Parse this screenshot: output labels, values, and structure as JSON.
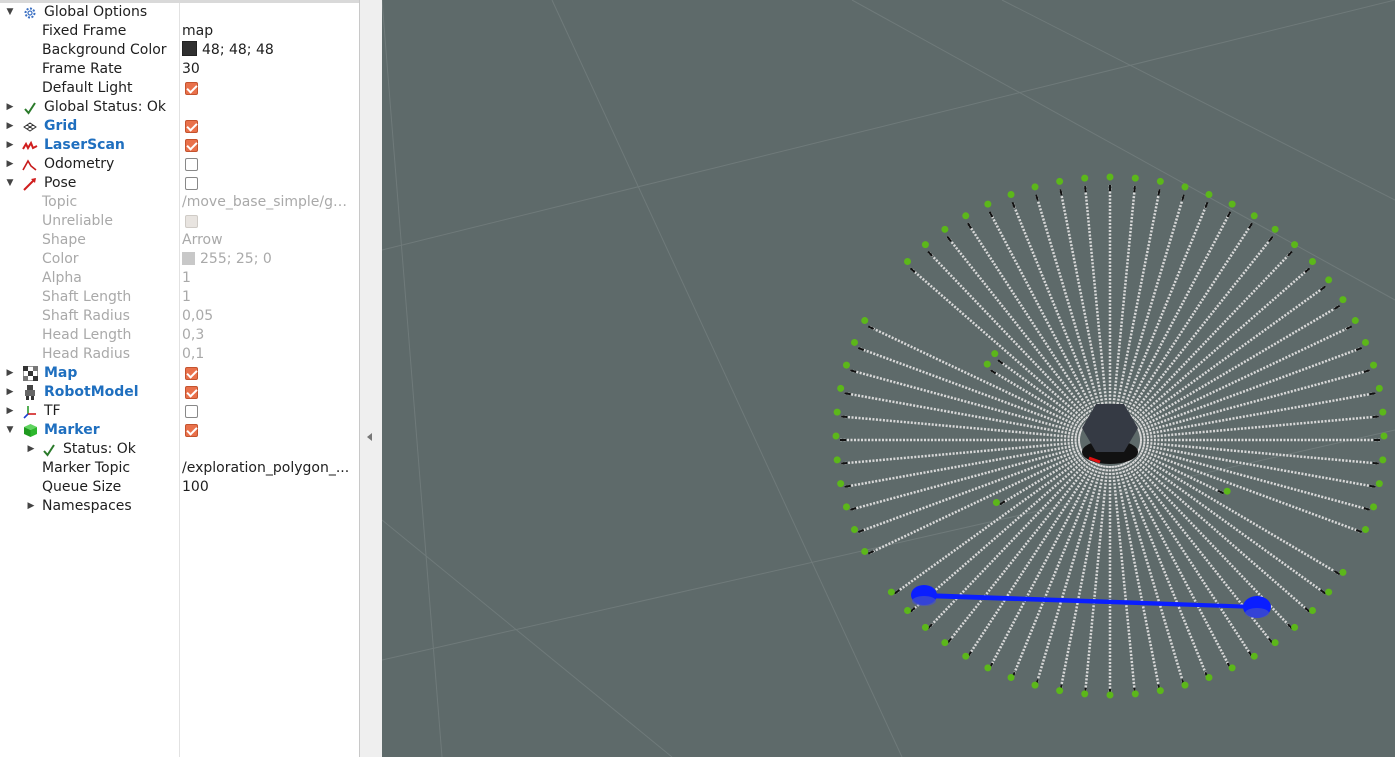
{
  "colors": {
    "viewport_bg": "#5e6a6a",
    "accent_checkbox": "#e9714b",
    "display_name": "#1f6fbf",
    "laser": "#d9d9d9",
    "endpoint": "#5cb71a",
    "marker": "#0a1eff",
    "robot": "#353a44"
  },
  "tree": {
    "global_options": {
      "label": "Global Options",
      "icon": "gear-icon",
      "fixed_frame": {
        "label": "Fixed Frame",
        "value": "map"
      },
      "background_color": {
        "label": "Background Color",
        "value": "48; 48; 48",
        "swatch": "#303030"
      },
      "frame_rate": {
        "label": "Frame Rate",
        "value": "30"
      },
      "default_light": {
        "label": "Default Light",
        "checked": true
      }
    },
    "global_status": {
      "label": "Global Status: Ok",
      "icon": "checkmark-icon"
    },
    "grid": {
      "label": "Grid",
      "icon": "grid-icon",
      "checked": true
    },
    "laserscan": {
      "label": "LaserScan",
      "icon": "laserscan-icon",
      "checked": true
    },
    "odometry": {
      "label": "Odometry",
      "icon": "odometry-icon",
      "checked": false
    },
    "pose": {
      "label": "Pose",
      "icon": "pose-arrow-icon",
      "checked": false,
      "topic": {
        "label": "Topic",
        "value": "/move_base_simple/goal"
      },
      "unreliable": {
        "label": "Unreliable"
      },
      "shape": {
        "label": "Shape",
        "value": "Arrow"
      },
      "color": {
        "label": "Color",
        "value": "255; 25; 0",
        "swatch": "#c8c8c8"
      },
      "alpha": {
        "label": "Alpha",
        "value": "1"
      },
      "shaft_length": {
        "label": "Shaft Length",
        "value": "1"
      },
      "shaft_radius": {
        "label": "Shaft Radius",
        "value": "0,05"
      },
      "head_length": {
        "label": "Head Length",
        "value": "0,3"
      },
      "head_radius": {
        "label": "Head Radius",
        "value": "0,1"
      }
    },
    "map": {
      "label": "Map",
      "icon": "map-icon",
      "checked": true
    },
    "robotmodel": {
      "label": "RobotModel",
      "icon": "robot-icon",
      "checked": true
    },
    "tf": {
      "label": "TF",
      "icon": "tf-icon",
      "checked": false
    },
    "marker": {
      "label": "Marker",
      "icon": "cube-icon",
      "checked": true,
      "status": {
        "label": "Status: Ok"
      },
      "marker_topic": {
        "label": "Marker Topic",
        "value": "/exploration_polygon_..."
      },
      "queue_size": {
        "label": "Queue Size",
        "value": "100"
      },
      "namespaces": {
        "label": "Namespaces"
      }
    }
  }
}
